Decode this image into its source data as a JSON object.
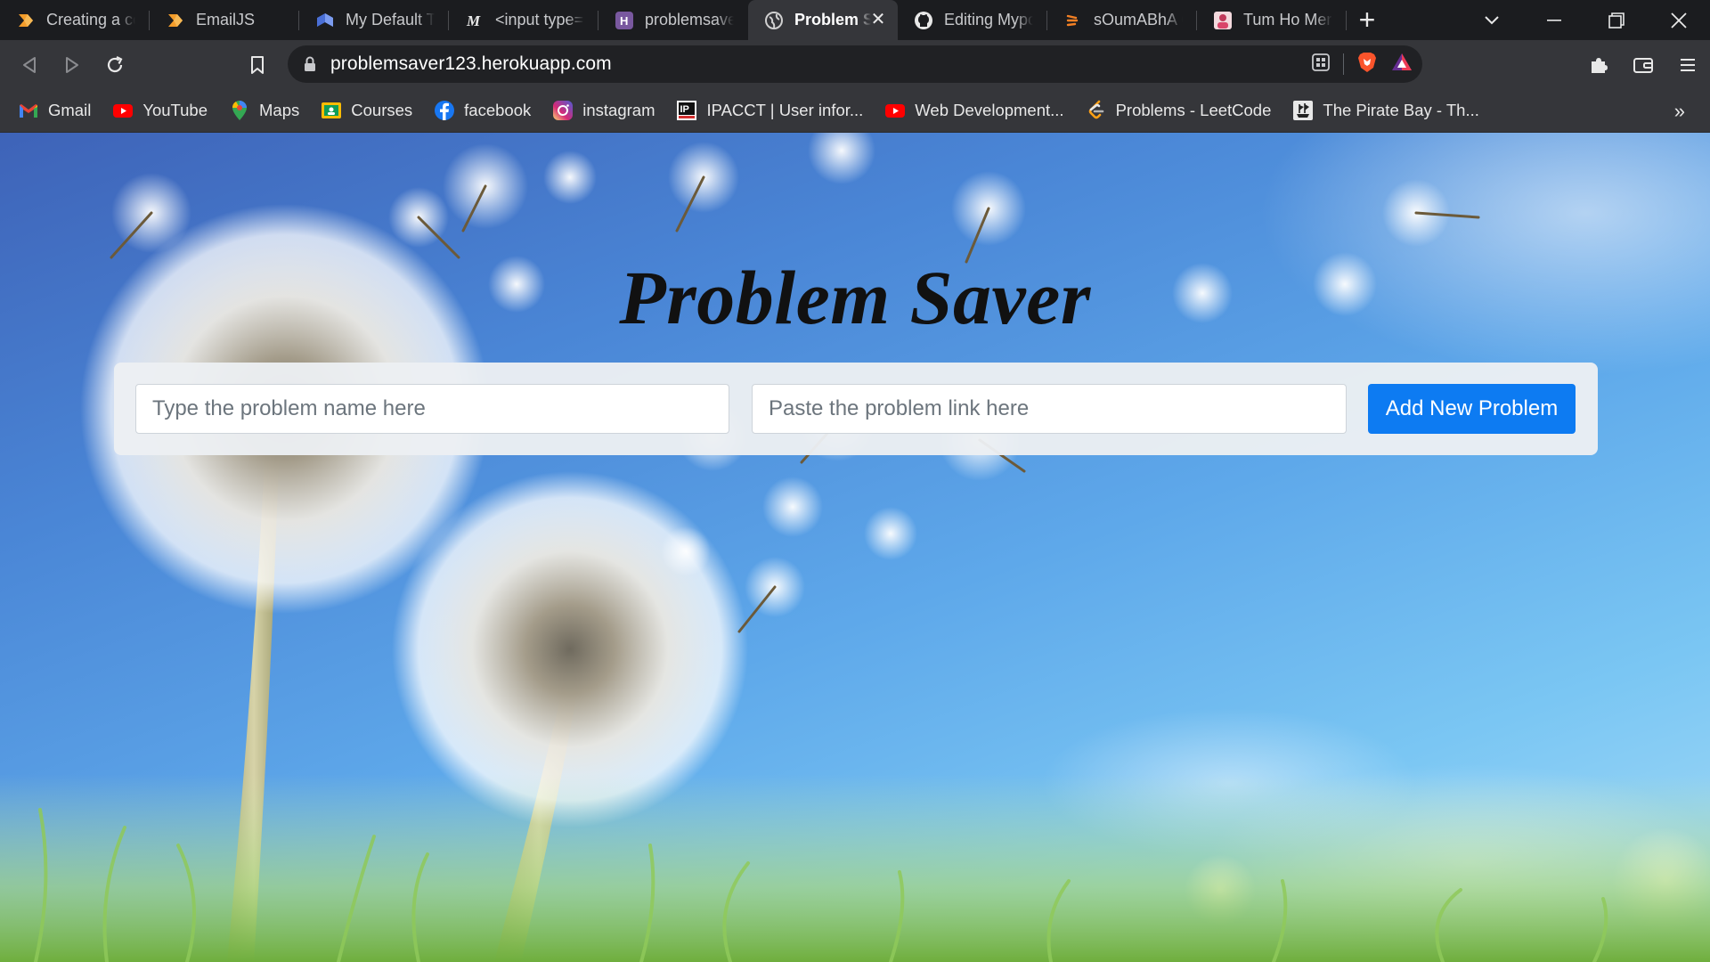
{
  "browser": {
    "tabs": [
      {
        "title": "Creating a con",
        "icon": "emailjs-logo-icon",
        "active": false
      },
      {
        "title": "EmailJS",
        "icon": "emailjs-logo-icon",
        "active": false
      },
      {
        "title": "My Default Te",
        "icon": "blue-shield-icon",
        "active": false
      },
      {
        "title": "<input type=\"",
        "icon": "m-logo-icon",
        "active": false
      },
      {
        "title": "problemsaver",
        "icon": "heroku-icon",
        "active": false
      },
      {
        "title": "Problem S",
        "icon": "globe-icon",
        "active": true
      },
      {
        "title": "Editing Mypor",
        "icon": "github-icon",
        "active": false
      },
      {
        "title": "sOumABhA Gi",
        "icon": "stackoverflow-icon",
        "active": false
      },
      {
        "title": "Tum Ho Mere",
        "icon": "avatar-icon",
        "active": false
      }
    ],
    "new_tab_label": "+",
    "url": "problemsaver123.herokuapp.com",
    "bookmarks": [
      {
        "label": "Gmail",
        "icon": "gmail-icon"
      },
      {
        "label": "YouTube",
        "icon": "youtube-icon"
      },
      {
        "label": "Maps",
        "icon": "maps-pin-icon"
      },
      {
        "label": "Courses",
        "icon": "classroom-icon"
      },
      {
        "label": "facebook",
        "icon": "facebook-icon"
      },
      {
        "label": "instagram",
        "icon": "instagram-icon"
      },
      {
        "label": "IPACCT | User infor...",
        "icon": "ipacct-icon"
      },
      {
        "label": "Web Development...",
        "icon": "youtube-icon"
      },
      {
        "label": "Problems - LeetCode",
        "icon": "leetcode-icon"
      },
      {
        "label": "The Pirate Bay - Th...",
        "icon": "pirate-ship-icon"
      }
    ],
    "bookmarks_overflow": "»"
  },
  "page": {
    "title": "Problem Saver",
    "form": {
      "name_placeholder": "Type the problem name here",
      "link_placeholder": "Paste the problem link here",
      "add_button_label": "Add New Problem"
    }
  },
  "colors": {
    "tabstrip": "#1b1c1f",
    "toolbar": "#35363a",
    "button_primary": "#0d7bf2",
    "sky_top": "#3e63b8",
    "sky_bottom": "#a8dcf7"
  }
}
